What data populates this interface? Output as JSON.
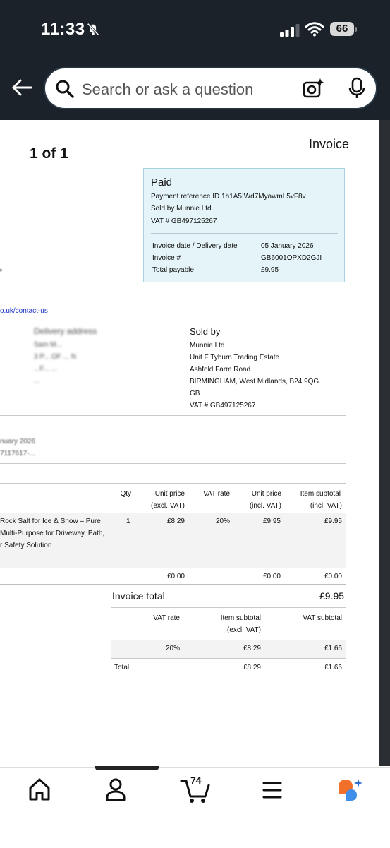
{
  "status_bar": {
    "time": "11:33",
    "battery": "66"
  },
  "search": {
    "placeholder": "Search or ask a question"
  },
  "document": {
    "page_count": "1 of 1",
    "title": "Invoice",
    "paid_box": {
      "status": "Paid",
      "payment_reference": "Payment reference ID 1h1A5IWd7MyawmL5vF8v",
      "sold_by": "Sold by Munnie Ltd",
      "vat": "VAT # GB497125267",
      "fields": [
        {
          "label": "Invoice date / Delivery date",
          "value": "05 January 2026"
        },
        {
          "label": "Invoice #",
          "value": "GB6001OPXD2GJI"
        },
        {
          "label": "Total payable",
          "value": "£9.95"
        }
      ]
    },
    "chevron": ">",
    "contact_link": "o.uk/contact-us",
    "delivery": {
      "heading": "Delivery address",
      "lines": [
        "Sam M...",
        "3 P... OF ... N",
        "...F... ...",
        "..."
      ]
    },
    "seller": {
      "heading": "Sold by",
      "lines": [
        "Munnie Ltd",
        "Unit F Tyburn Trading Estate",
        "Ashfold Farm Road",
        "BIRMINGHAM, West Midlands, B24 9QG",
        "GB",
        "VAT # GB497125267"
      ]
    },
    "order_info": [
      "nuary 2026",
      "7117617-..."
    ],
    "items_table": {
      "headers": {
        "qty": "Qty",
        "unit_price_excl": [
          "Unit price",
          "(excl. VAT)"
        ],
        "vat_rate": "VAT rate",
        "unit_price_incl": [
          "Unit price",
          "(incl. VAT)"
        ],
        "subtotal_incl": [
          "Item subtotal",
          "(incl. VAT)"
        ]
      },
      "row": {
        "description": [
          "Rock Salt for Ice & Snow – Pure",
          "Multi-Purpose for Driveway, Path,",
          "r Safety Solution"
        ],
        "qty": "1",
        "unit_price_excl": "£8.29",
        "vat_rate": "20%",
        "unit_price_incl": "£9.95",
        "subtotal_incl": "£9.95"
      },
      "shipping_row": {
        "unit_price_excl": "£0.00",
        "unit_price_incl": "£0.00",
        "subtotal_incl": "£0.00"
      }
    },
    "invoice_total": {
      "label": "Invoice total",
      "value": "£9.95"
    },
    "vat_summary": {
      "headers": {
        "vat_rate": "VAT rate",
        "item_subtotal": [
          "Item subtotal",
          "(excl. VAT)"
        ],
        "vat_subtotal": "VAT subtotal"
      },
      "row": {
        "vat_rate": "20%",
        "item_subtotal": "£8.29",
        "vat_subtotal": "£1.66"
      },
      "total": {
        "label": "Total",
        "item_subtotal": "£8.29",
        "vat_subtotal": "£1.66"
      }
    }
  },
  "bottom_nav": {
    "items": [
      {
        "icon": "home-icon"
      },
      {
        "icon": "account-icon"
      },
      {
        "icon": "cart-icon",
        "count": "74"
      },
      {
        "icon": "menu-icon"
      },
      {
        "icon": "rufus-assistant-icon"
      }
    ]
  }
}
